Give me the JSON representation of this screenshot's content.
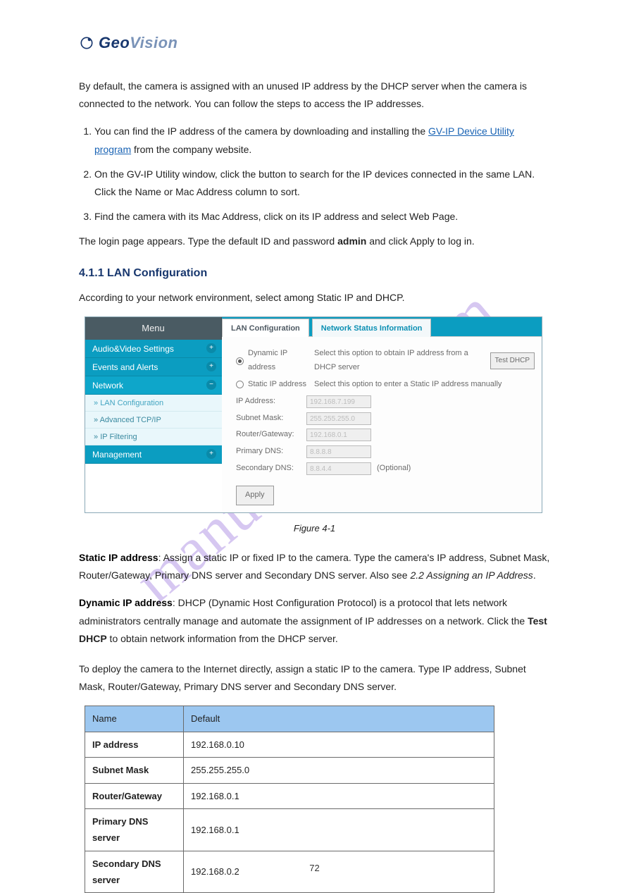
{
  "watermark": "manualshive.com",
  "logo": {
    "brand_prefix": "Geo",
    "brand_suffix": "Vision"
  },
  "doc": {
    "intro_line1_pre": "By default, the camera is assigned with an unused IP address by the DHCP server when the",
    "intro_line1_post": "camera is connected to the network. You can follow the steps to access the IP addresses.",
    "step1_prefix": "You can find the IP address of the camera by downloading and installing the ",
    "step1_link": "GV-IP Device Utility program",
    "step1_suffix": " from the company website.",
    "step2": "On the GV-IP Utility window, click the  button to search for the IP devices connected in the same LAN. Click the Name or Mac Address column to sort.",
    "step3": "Find the camera with its Mac Address, click on its IP address and select Web Page.",
    "login_note_prefix": "The login page appears. Type the default ID and password ",
    "login_note_bold": "admin",
    "login_note_suffix": " and click Apply to log in.",
    "section_lan": "4.1.1 LAN Configuration",
    "lan_para": "According to your network environment, select among Static IP and DHCP."
  },
  "screenshot": {
    "menu_header": "Menu",
    "menu_items": [
      "Audio&Video Settings",
      "Events and Alerts",
      "Network",
      "Management"
    ],
    "subitems": [
      "LAN Configuration",
      "Advanced TCP/IP",
      "IP Filtering"
    ],
    "tabs": [
      "LAN Configuration",
      "Network Status Information"
    ],
    "opt_dynamic": "Dynamic IP address",
    "opt_dynamic_desc": "Select this option to obtain IP address from a DHCP server",
    "opt_static": "Static IP address",
    "opt_static_desc": "Select this option to enter a Static IP address manually",
    "test_dhcp": "Test DHCP",
    "fields": {
      "ip_lbl": "IP Address:",
      "ip_val": "192.168.7.199",
      "mask_lbl": "Subnet Mask:",
      "mask_val": "255.255.255.0",
      "gw_lbl": "Router/Gateway:",
      "gw_val": "192.168.0.1",
      "dns1_lbl": "Primary DNS:",
      "dns1_val": "8.8.8.8",
      "dns2_lbl": "Secondary DNS:",
      "dns2_val": "8.8.4.4",
      "optional": "(Optional)"
    },
    "apply": "Apply",
    "figure_caption": "Figure 4-1"
  },
  "static_ip": {
    "heading": "Static IP address",
    "para_pre": "Assign a static IP or fixed IP to the camera. Type the camera's IP address, Subnet Mask, Router/Gateway, Primary DNS server and Secondary DNS server. Also see ",
    "para_link": "2.2 Assigning an IP Address",
    "para_post": "."
  },
  "dynamic_ip": {
    "heading": "Dynamic IP address",
    "para_pre": "DHCP (Dynamic Host Configuration Protocol) is a protocol that lets network administrators centrally manage and automate the assignment of IP addresses on a network. Click the ",
    "para_bold": "Test DHCP",
    "para_post": " to obtain network information from the DHCP server."
  },
  "theory": {
    "para": "To deploy the camera to the Internet directly, assign a static IP to the camera. Type IP address, Subnet Mask, Router/Gateway, Primary DNS server and Secondary DNS server.",
    "table_name": "Name",
    "table_default": "Default",
    "rows": [
      {
        "k": "IP address",
        "v": "192.168.0.10"
      },
      {
        "k": "Subnet Mask",
        "v": "255.255.255.0"
      },
      {
        "k": "Router/Gateway",
        "v": "192.168.0.1"
      },
      {
        "k": "Primary DNS server",
        "v": "192.168.0.1"
      },
      {
        "k": "Secondary DNS server",
        "v": "192.168.0.2"
      }
    ]
  },
  "page_number": "72"
}
